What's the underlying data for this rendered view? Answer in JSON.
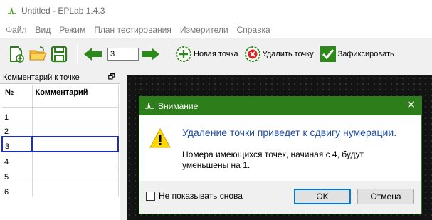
{
  "window": {
    "title": "Untitled - EPLab 1.4.3"
  },
  "menu": {
    "items": [
      "Файл",
      "Вид",
      "Режим",
      "План тестирования",
      "Измерители",
      "Справка"
    ]
  },
  "toolbar": {
    "point_number": "3",
    "add_point_label": "Новая точка",
    "delete_point_label": "Удалить точку",
    "fix_label": "Зафиксировать"
  },
  "comments_panel": {
    "title": "Комментарий к точке",
    "col_number": "№",
    "col_comment": "Комментарий",
    "rows": [
      {
        "num": "1",
        "comment": ""
      },
      {
        "num": "2",
        "comment": ""
      },
      {
        "num": "3",
        "comment": ""
      },
      {
        "num": "4",
        "comment": ""
      },
      {
        "num": "5",
        "comment": ""
      },
      {
        "num": "6",
        "comment": ""
      }
    ]
  },
  "dialog": {
    "title": "Внимание",
    "main_message": "Удаление точки приведет к сдвигу нумерации.",
    "detail_line1": "Номера имеющихся точек, начиная с 4, будут",
    "detail_line2": "уменьшены на 1.",
    "checkbox_label": "Не показывать снова",
    "ok_label": "OK",
    "cancel_label": "Отмена"
  },
  "colors": {
    "dialog_title_bg": "#2d7d1a",
    "message_blue": "#1c4aa6",
    "selection": "#1c2fb5"
  }
}
